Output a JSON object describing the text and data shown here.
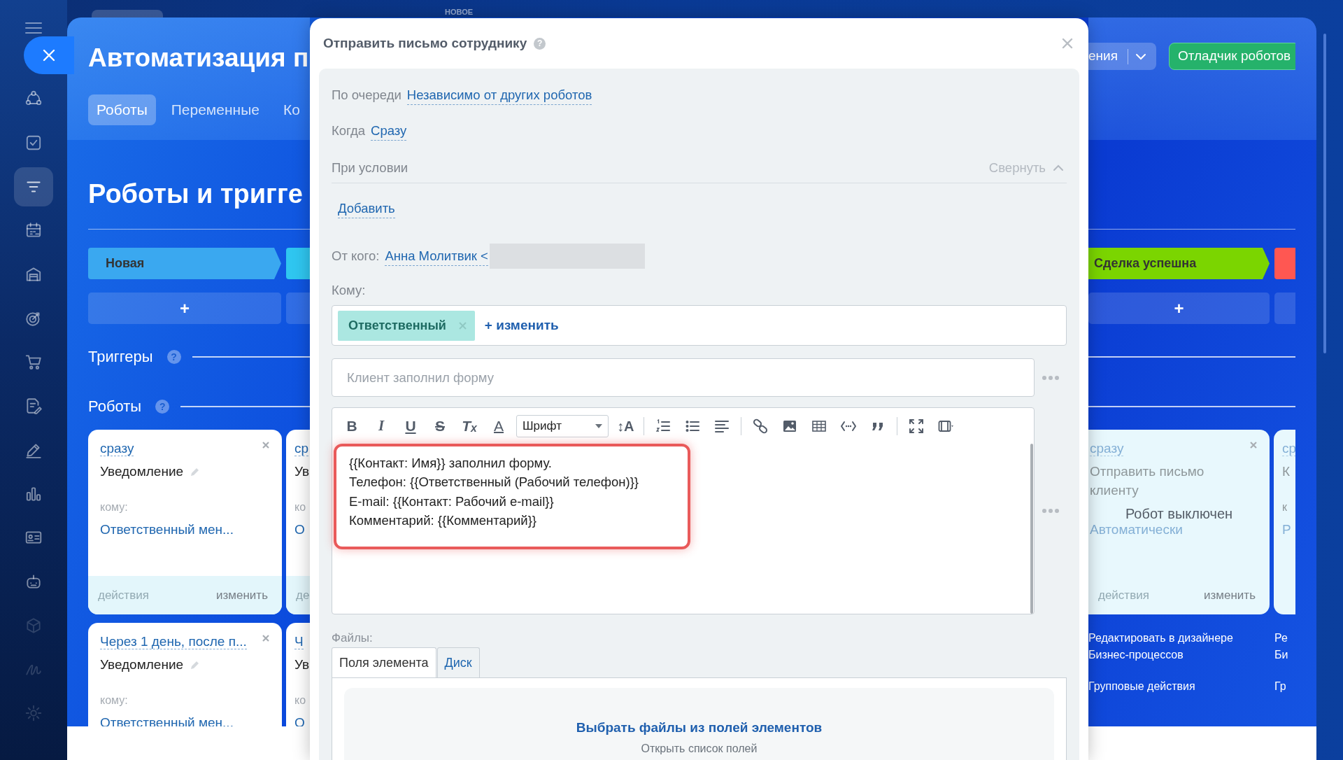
{
  "sidebar": {
    "items": [
      {
        "selected": false,
        "dimmed": false
      },
      {
        "selected": false,
        "dimmed": false
      },
      {
        "selected": true,
        "dimmed": false
      },
      {
        "selected": false,
        "dimmed": false
      },
      {
        "selected": false,
        "dimmed": false
      },
      {
        "selected": false,
        "dimmed": false
      },
      {
        "selected": false,
        "dimmed": false
      },
      {
        "selected": false,
        "dimmed": false
      },
      {
        "selected": false,
        "dimmed": false
      },
      {
        "selected": false,
        "dimmed": false
      },
      {
        "selected": false,
        "dimmed": false
      },
      {
        "selected": false,
        "dimmed": false
      },
      {
        "selected": false,
        "dimmed": true
      },
      {
        "selected": false,
        "dimmed": true
      },
      {
        "selected": false,
        "dimmed": true
      }
    ]
  },
  "top": {
    "tab_label": "НОВОЕ"
  },
  "header": {
    "title": "Автоматизация п",
    "tabs": [
      {
        "label": "Роботы",
        "selected": true
      },
      {
        "label": "Переменные",
        "selected": false
      },
      {
        "label": "Ко",
        "selected": false
      }
    ],
    "split_button": "ения",
    "debugger_button": "Отладчик роботов"
  },
  "heading": "Роботы и тригге",
  "triggers": {
    "label": "Триггеры",
    "help": "?"
  },
  "robots": {
    "label": "Роботы",
    "help": "?"
  },
  "left": {
    "stages": [
      {
        "label": "Новая",
        "color": "#3aa8f0",
        "add": "+"
      },
      {
        "color": "#2fc6f0"
      }
    ],
    "cards": [
      [
        {
          "when": "сразу",
          "name": "Уведомление",
          "to_label": "кому:",
          "to": "Ответственный мен...",
          "actions": "действия",
          "edit": "изменить",
          "disabled": false
        },
        {
          "when": "ср",
          "name": "Ув",
          "to_label": "ко",
          "to": "О",
          "actions": "де",
          "disabled": false
        }
      ],
      [
        {
          "when": "Через 1 день, после п...",
          "name": "Уведомление",
          "to_label": "кому:",
          "to": "Ответственный мен...",
          "disabled": false
        },
        {
          "when": "Ч",
          "name": "Ув",
          "to_label": "ко",
          "to": "О",
          "disabled": false
        }
      ]
    ]
  },
  "right": {
    "stages": [
      {
        "label": "Сделка успешна",
        "color": "#7bd500",
        "add": "+"
      },
      {
        "color": "#ff5752"
      }
    ],
    "cards": [
      [
        {
          "when": "сразу",
          "name": "Отправить письмо клиенту",
          "to": "Автоматически",
          "actions": "действия",
          "edit": "изменить",
          "disabled": true,
          "status": "Робот выключен"
        },
        {
          "when": "ср",
          "name": "К",
          "to_label": "к",
          "to": "Р",
          "disabled": true
        }
      ]
    ],
    "links": [
      [
        "Редактировать в дизайнере Бизнес-процессов",
        "Групповые действия"
      ],
      [
        "Ре Би",
        "Гр"
      ]
    ]
  },
  "modal": {
    "title": "Отправить письмо сотруднику",
    "help": "?",
    "order_label": "По очереди",
    "order_value": "Независимо от других роботов",
    "when_label": "Когда",
    "when_value": "Сразу",
    "condition_label": "При условии",
    "collapse": "Свернуть",
    "add_condition": "Добавить",
    "from_label": "От кого:",
    "from_value": "Анна Молитвик <",
    "to_label": "Кому:",
    "recipients": [
      {
        "label": "Ответственный"
      }
    ],
    "change": "+ изменить",
    "subject_placeholder": "Клиент заполнил форму",
    "toolbar": [
      "B",
      "I",
      "U",
      "S",
      "T$_{x}$",
      "A"
    ],
    "font_select": "Шрифт",
    "size_button": "↕A",
    "body": [
      "{{Контакт: Имя}} заполнил форму.",
      "Телефон: {{Ответственный (Рабочий телефон)}}",
      "E-mail: {{Контакт: Рабочий e-mail}}",
      "Комментарий: {{Комментарий}}"
    ],
    "files_label": "Файлы:",
    "file_tabs": [
      {
        "label": "Поля элемента",
        "selected": true
      },
      {
        "label": "Диск",
        "selected": false
      }
    ],
    "pick_files": "Выбрать файлы из полей элементов",
    "pick_files_hint": "Открыть список полей"
  }
}
